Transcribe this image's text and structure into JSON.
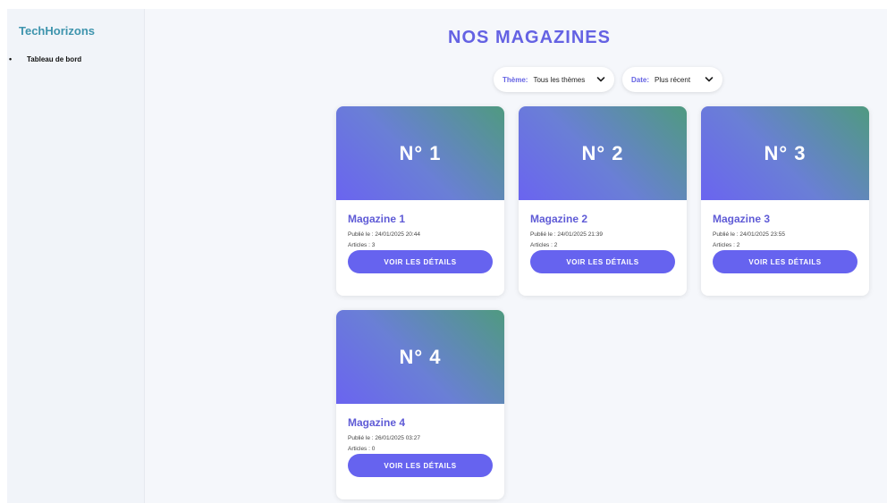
{
  "sidebar": {
    "brand": "TechHorizons",
    "items": [
      {
        "label": "Tableau de bord"
      }
    ]
  },
  "main": {
    "title": "NOS MAGAZINES",
    "filters": {
      "theme": {
        "label": "Thème:",
        "value": "Tous les thèmes"
      },
      "date": {
        "label": "Date:",
        "value": "Plus récent"
      }
    },
    "magazines": [
      {
        "badge": "N° 1",
        "title": "Magazine 1",
        "published": "Publié le : 24/01/2025 20:44",
        "articles": "Articles : 3",
        "button": "VOIR LES DÉTAILS"
      },
      {
        "badge": "N° 2",
        "title": "Magazine 2",
        "published": "Publié le : 24/01/2025 21:39",
        "articles": "Articles : 2",
        "button": "VOIR LES DÉTAILS"
      },
      {
        "badge": "N° 3",
        "title": "Magazine 3",
        "published": "Publié le : 24/01/2025 23:55",
        "articles": "Articles : 2",
        "button": "VOIR LES DÉTAILS"
      },
      {
        "badge": "N° 4",
        "title": "Magazine 4",
        "published": "Publié le : 26/01/2025 03:27",
        "articles": "Articles : 0",
        "button": "VOIR LES DÉTAILS"
      }
    ]
  },
  "colors": {
    "brand": "#3e94ad",
    "accent": "#6663ef",
    "title": "#6462e3"
  }
}
